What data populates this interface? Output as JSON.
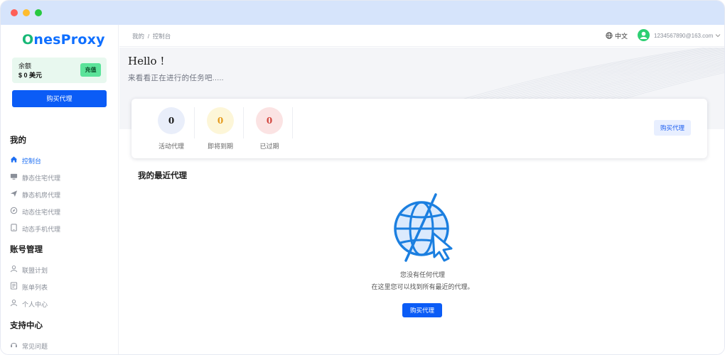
{
  "brand": {
    "name_part1": "O",
    "name_part2": "nesProxy"
  },
  "sidebar": {
    "balance_label": "余额",
    "balance_value": "$ 0 美元",
    "recharge_label": "充值",
    "buy_label": "购买代理",
    "sections": [
      {
        "title": "我的",
        "items": [
          {
            "label": "控制台",
            "icon": "home-icon",
            "active": true
          },
          {
            "label": "静态住宅代理",
            "icon": "monitor-icon"
          },
          {
            "label": "静态机房代理",
            "icon": "send-icon"
          },
          {
            "label": "动态住宅代理",
            "icon": "compass-icon"
          },
          {
            "label": "动态手机代理",
            "icon": "tablet-icon"
          }
        ]
      },
      {
        "title": "账号管理",
        "items": [
          {
            "label": "联盟计划",
            "icon": "user-icon"
          },
          {
            "label": "账单列表",
            "icon": "document-icon"
          },
          {
            "label": "个人中心",
            "icon": "user-icon"
          }
        ]
      },
      {
        "title": "支持中心",
        "items": [
          {
            "label": "常见问题",
            "icon": "headset-icon"
          }
        ]
      }
    ]
  },
  "topbar": {
    "breadcrumb": "我的  /  控制台",
    "language": "中文",
    "email": "1234567890@163.com"
  },
  "hero": {
    "greeting": "Hello !",
    "subtitle": "来看看正在进行的任务吧....."
  },
  "stats": [
    {
      "value": "0",
      "label": "活动代理",
      "bg": "#e9eefa",
      "color": "#1a1a1a"
    },
    {
      "value": "0",
      "label": "即将到期",
      "bg": "#fdf6d8",
      "color": "#e59a1c"
    },
    {
      "value": "0",
      "label": "已过期",
      "bg": "#fbe3e3",
      "color": "#d2473f"
    }
  ],
  "stats_buy_label": "购买代理",
  "recent": {
    "title": "我的最近代理",
    "empty_title": "您没有任何代理",
    "empty_desc": "在这里您可以找到所有最近的代理。",
    "buy_label": "购买代理"
  },
  "colors": {
    "accent": "#0b5cf6",
    "brand_green": "#18b877",
    "titlebar": "#d6e4fb"
  }
}
